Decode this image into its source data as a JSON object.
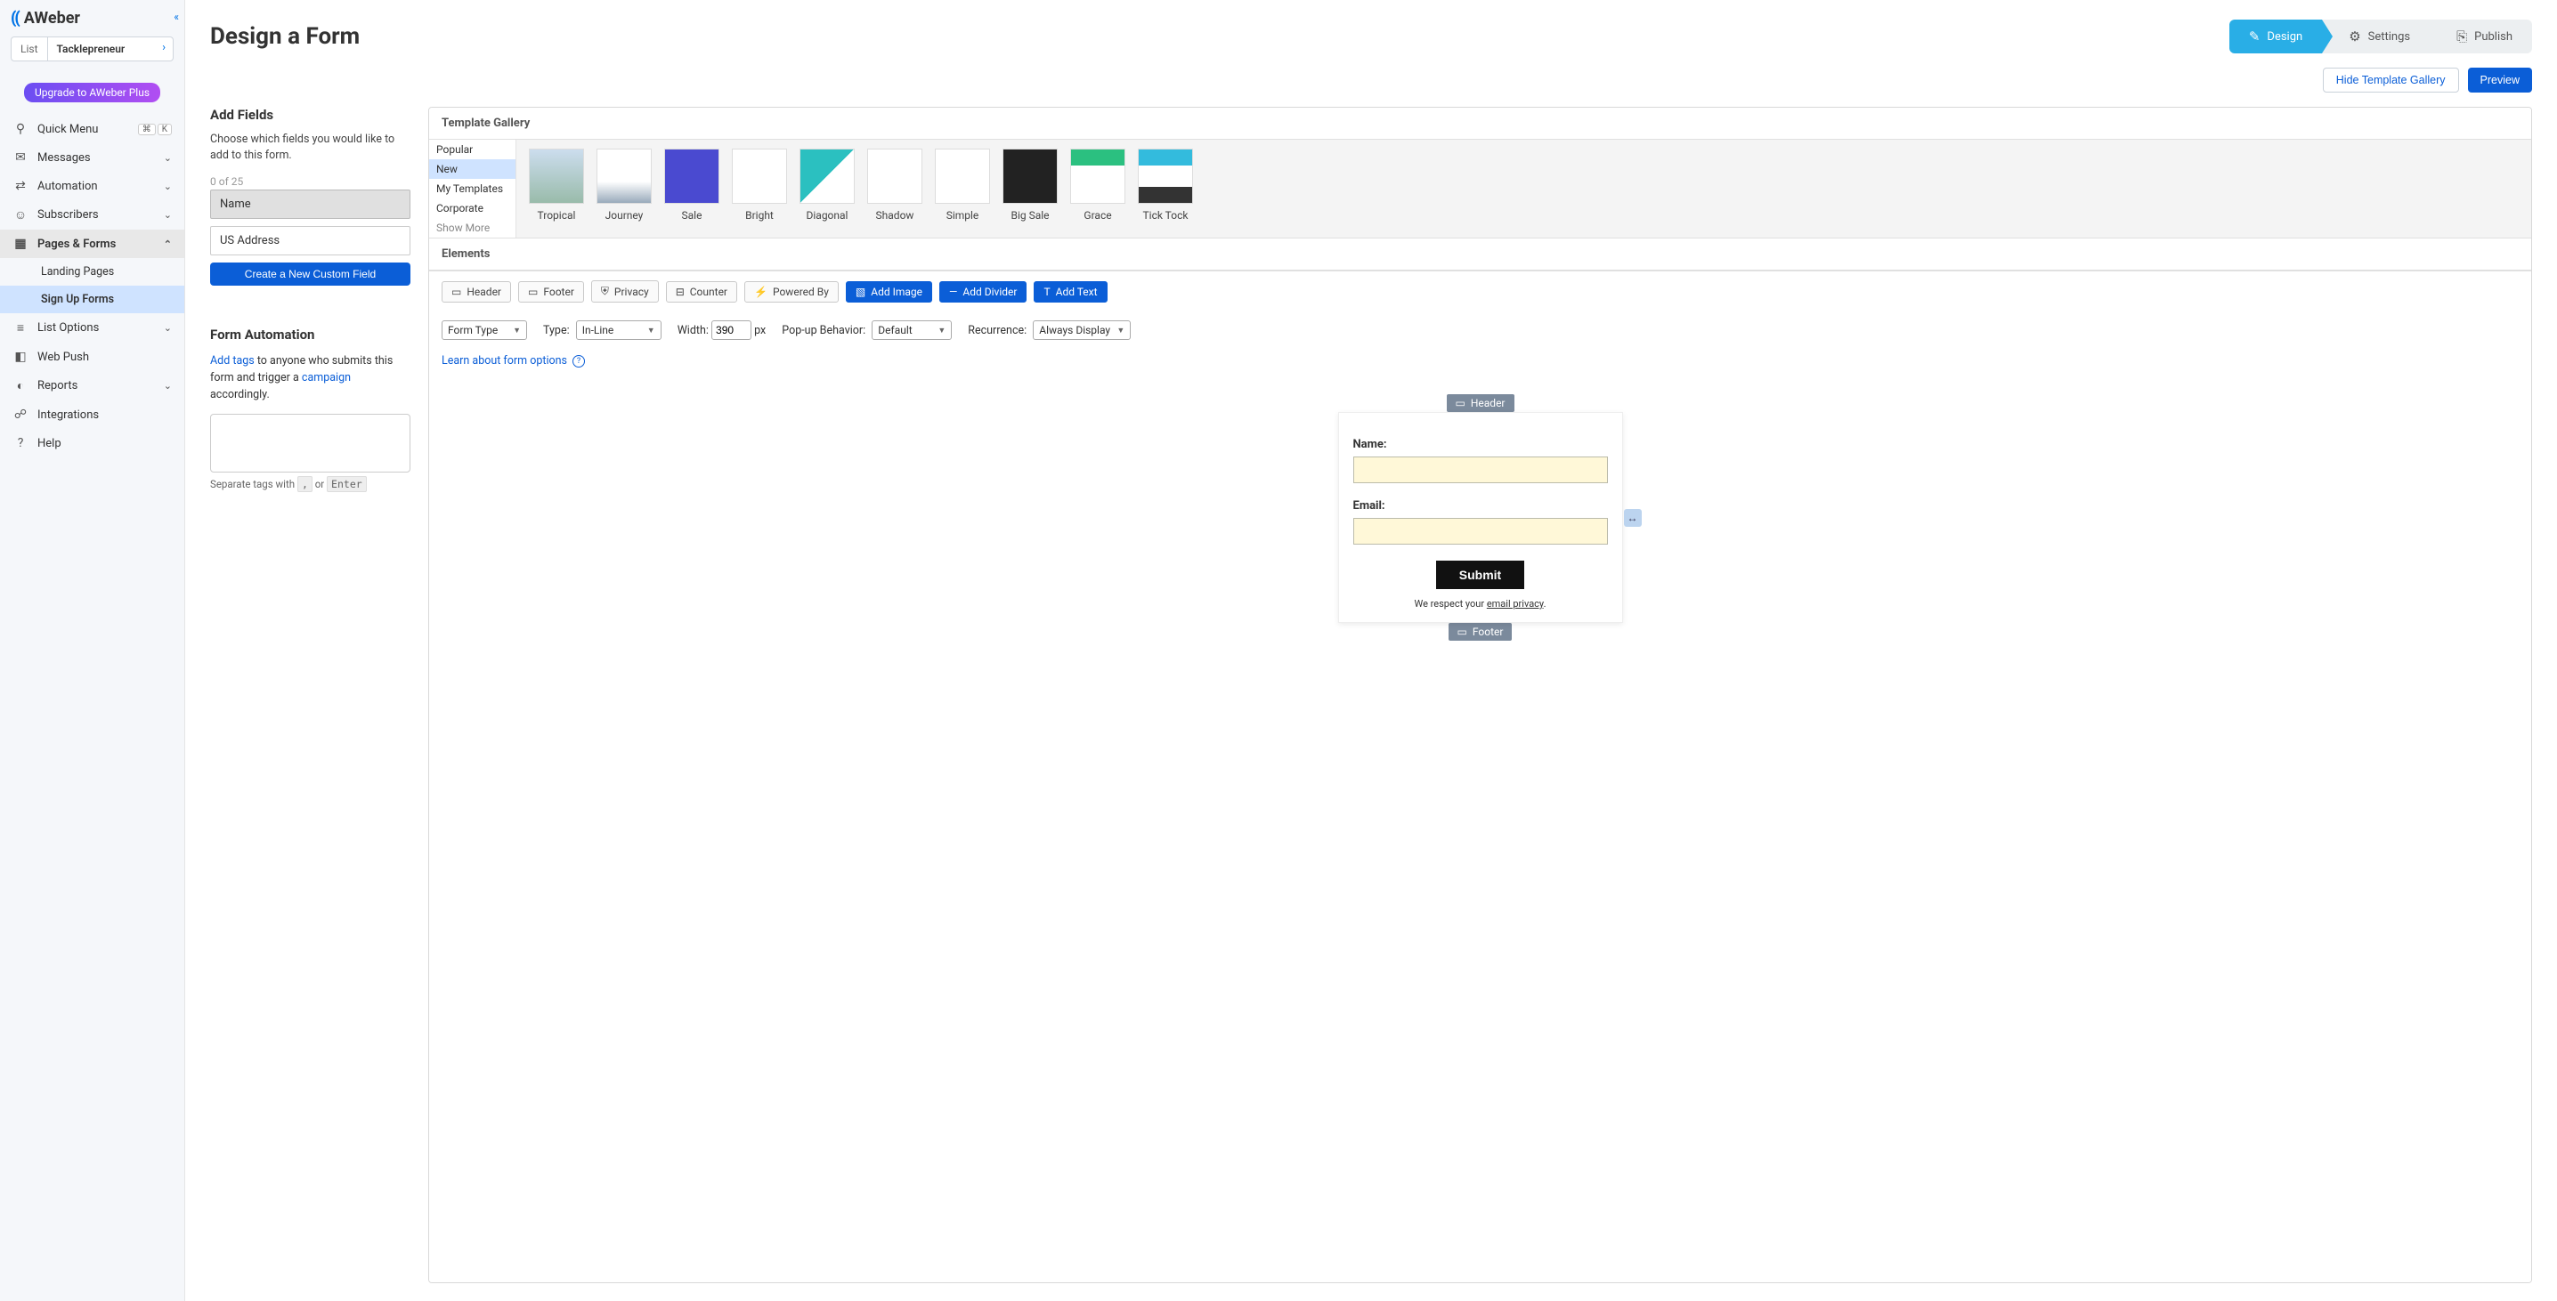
{
  "app": {
    "logo_text": "AWeber",
    "list_label": "List",
    "list_value": "Tacklepreneur",
    "upgrade_label": "Upgrade to AWeber Plus"
  },
  "nav": {
    "quick_menu": "Quick Menu",
    "shortcut_keys": [
      "⌘",
      "K"
    ],
    "messages": "Messages",
    "automation": "Automation",
    "subscribers": "Subscribers",
    "pages_forms": "Pages & Forms",
    "landing_pages": "Landing Pages",
    "sign_up_forms": "Sign Up Forms",
    "list_options": "List Options",
    "web_push": "Web Push",
    "reports": "Reports",
    "integrations": "Integrations",
    "help": "Help"
  },
  "page": {
    "title": "Design a Form",
    "steps": {
      "design": "Design",
      "settings": "Settings",
      "publish": "Publish"
    },
    "hide_gallery": "Hide Template Gallery",
    "preview": "Preview"
  },
  "fields_panel": {
    "header": "Add Fields",
    "sub": "Choose which fields you would like to add to this form.",
    "counter": "0 of 25",
    "items": [
      "Name",
      "US Address"
    ],
    "create_btn": "Create a New Custom Field"
  },
  "form_auto": {
    "header": "Form Automation",
    "add_tags": "Add tags",
    "text_mid": " to anyone who submits this form and trigger a ",
    "campaign": "campaign",
    "text_end": " accordingly.",
    "hint_pre": "Separate tags with ",
    "hint_comma": ",",
    "hint_or": " or ",
    "hint_enter": "Enter"
  },
  "gallery": {
    "header": "Template Gallery",
    "cats": [
      "Popular",
      "New",
      "My Templates",
      "Corporate",
      "Show More"
    ],
    "thumbs": [
      "Tropical",
      "Journey",
      "Sale",
      "Bright",
      "Diagonal",
      "Shadow",
      "Simple",
      "Big Sale",
      "Grace",
      "Tick Tock"
    ]
  },
  "elements": {
    "header": "Elements",
    "chips": [
      "Header",
      "Footer",
      "Privacy",
      "Counter",
      "Powered By"
    ],
    "add_image": "Add Image",
    "add_divider": "Add Divider",
    "add_text": "Add Text"
  },
  "options": {
    "form_type": "Form Type",
    "type_label": "Type:",
    "type_val": "In-Line",
    "width_label": "Width:",
    "width_val": "390",
    "width_unit": "px",
    "popup_label": "Pop-up Behavior:",
    "popup_val": "Default",
    "recur_label": "Recurrence:",
    "recur_val": "Always Display",
    "learn": "Learn about form options"
  },
  "canvas": {
    "header_tag": "Header",
    "footer_tag": "Footer",
    "name_label": "Name:",
    "email_label": "Email:",
    "submit": "Submit",
    "privacy_pre": "We respect your ",
    "privacy_link": "email privacy",
    "privacy_post": "."
  }
}
